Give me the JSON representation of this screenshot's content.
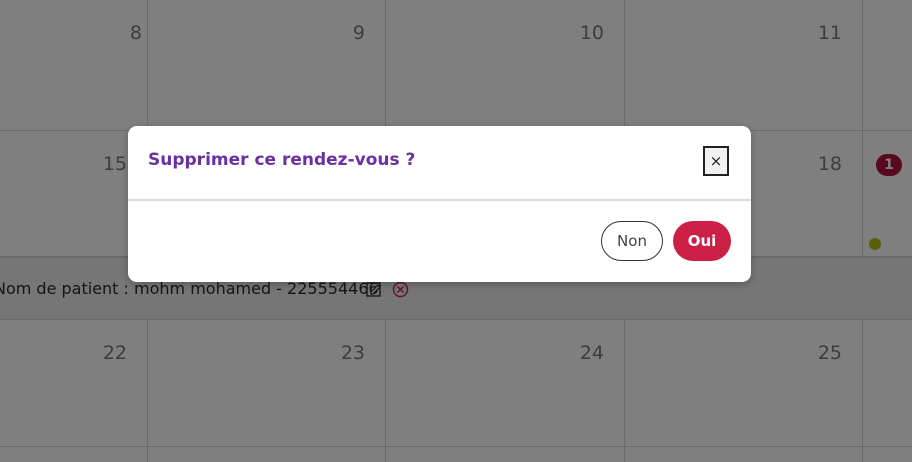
{
  "calendar": {
    "days": [
      "8",
      "9",
      "10",
      "11",
      "15",
      "18",
      "22",
      "23",
      "24",
      "25"
    ],
    "badge_count": "1",
    "event_text": "Nom de patient : mohm mohamed - 225554466"
  },
  "dialog": {
    "title": "Supprimer ce rendez-vous ?",
    "close_label": "×",
    "cancel_label": "Non",
    "confirm_label": "Oui"
  },
  "colors": {
    "title": "#6a2fa0",
    "confirm": "#cc1f46",
    "badge": "#b0123a",
    "dot": "#b5bd12"
  },
  "icons": [
    "edit-icon",
    "delete-icon",
    "close-icon"
  ]
}
